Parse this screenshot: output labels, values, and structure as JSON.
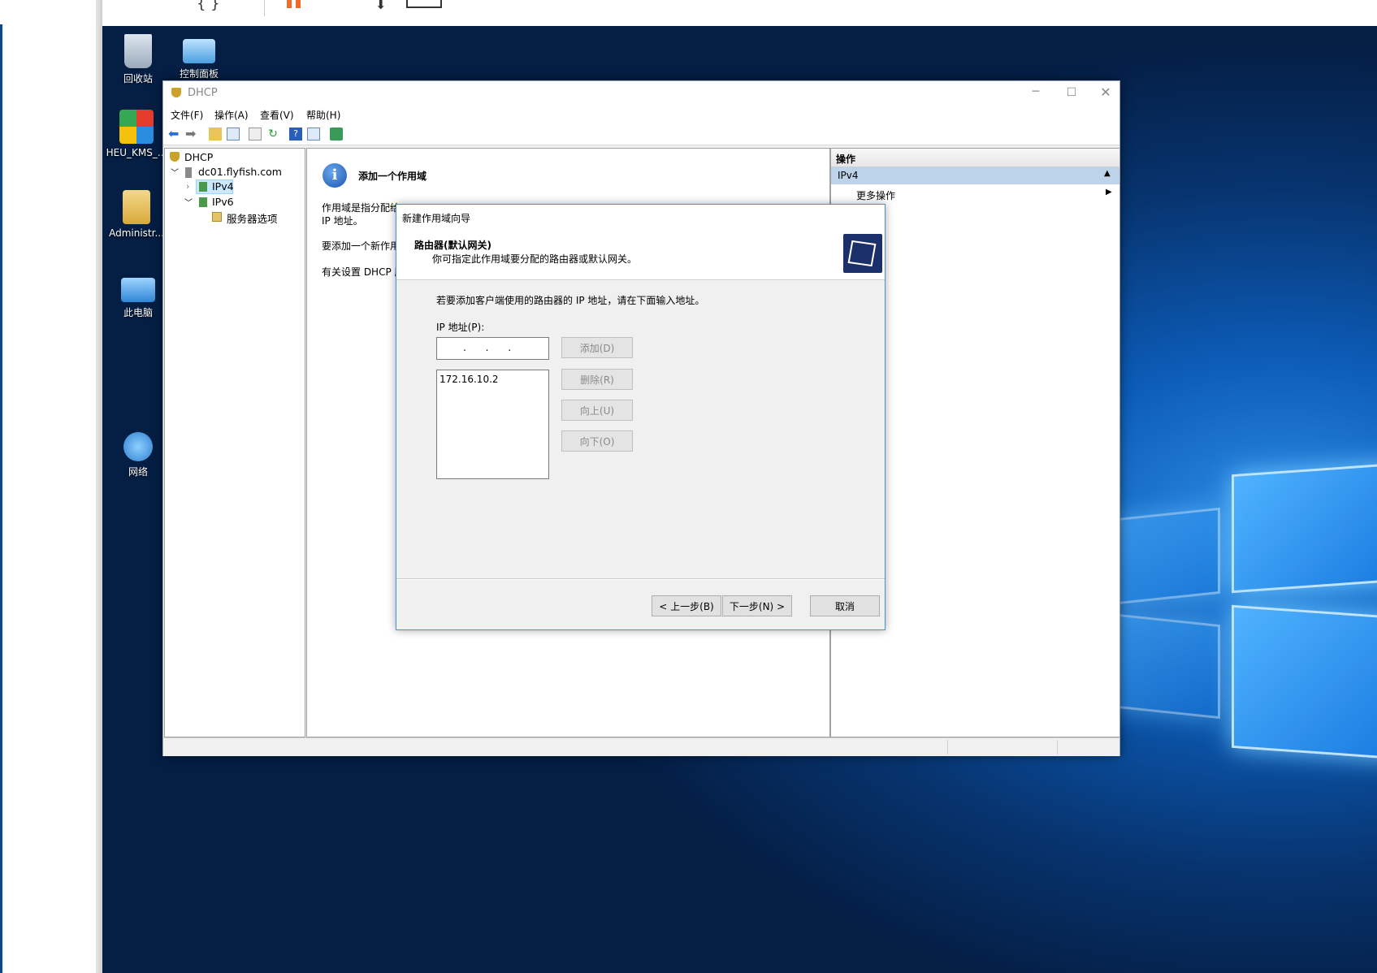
{
  "desktop_icons": [
    {
      "id": "recycle",
      "label": "回收站",
      "icon": "recycle-bin-icon"
    },
    {
      "id": "control",
      "label": "控制面板",
      "icon": "control-panel-icon"
    },
    {
      "id": "heu",
      "label": "HEU_KMS_...",
      "icon": "heu-kms-icon"
    },
    {
      "id": "admin",
      "label": "Administr...",
      "icon": "user-folder-icon"
    },
    {
      "id": "pc",
      "label": "此电脑",
      "icon": "computer-icon"
    },
    {
      "id": "net",
      "label": "网络",
      "icon": "network-icon"
    }
  ],
  "window": {
    "title": "DHCP",
    "menu": [
      "文件(F)",
      "操作(A)",
      "查看(V)",
      "帮助(H)"
    ]
  },
  "tree": {
    "root": "DHCP",
    "server": "dc01.flyfish.com",
    "ipv4": "IPv4",
    "ipv6": "IPv6",
    "server_options": "服务器选项"
  },
  "center": {
    "heading": "添加一个作用域",
    "para1_line1": "作用域是指分配给",
    "para1_line2": "IP 地址。",
    "para2": "要添加一个新作用",
    "para3": "有关设置 DHCP 服"
  },
  "actions": {
    "header": "操作",
    "section": "IPv4",
    "more": "更多操作"
  },
  "wizard": {
    "title": "新建作用域向导",
    "heading": "路由器(默认网关)",
    "subheading": "你可指定此作用域要分配的路由器或默认网关。",
    "instruction": "若要添加客户端使用的路由器的 IP 地址，请在下面输入地址。",
    "ip_label": "IP 地址(P):",
    "ip_input_value": ".   .   .",
    "list_items": [
      "172.16.10.2"
    ],
    "add_label": "添加(D)",
    "remove_label": "删除(R)",
    "up_label": "向上(U)",
    "down_label": "向下(O)",
    "back_label": "< 上一步(B)",
    "next_label": "下一步(N) >",
    "cancel_label": "取消"
  },
  "colors": {
    "accent": "#1a7be0",
    "selection": "#cce8ff",
    "actions_section": "#bcd3ea"
  }
}
